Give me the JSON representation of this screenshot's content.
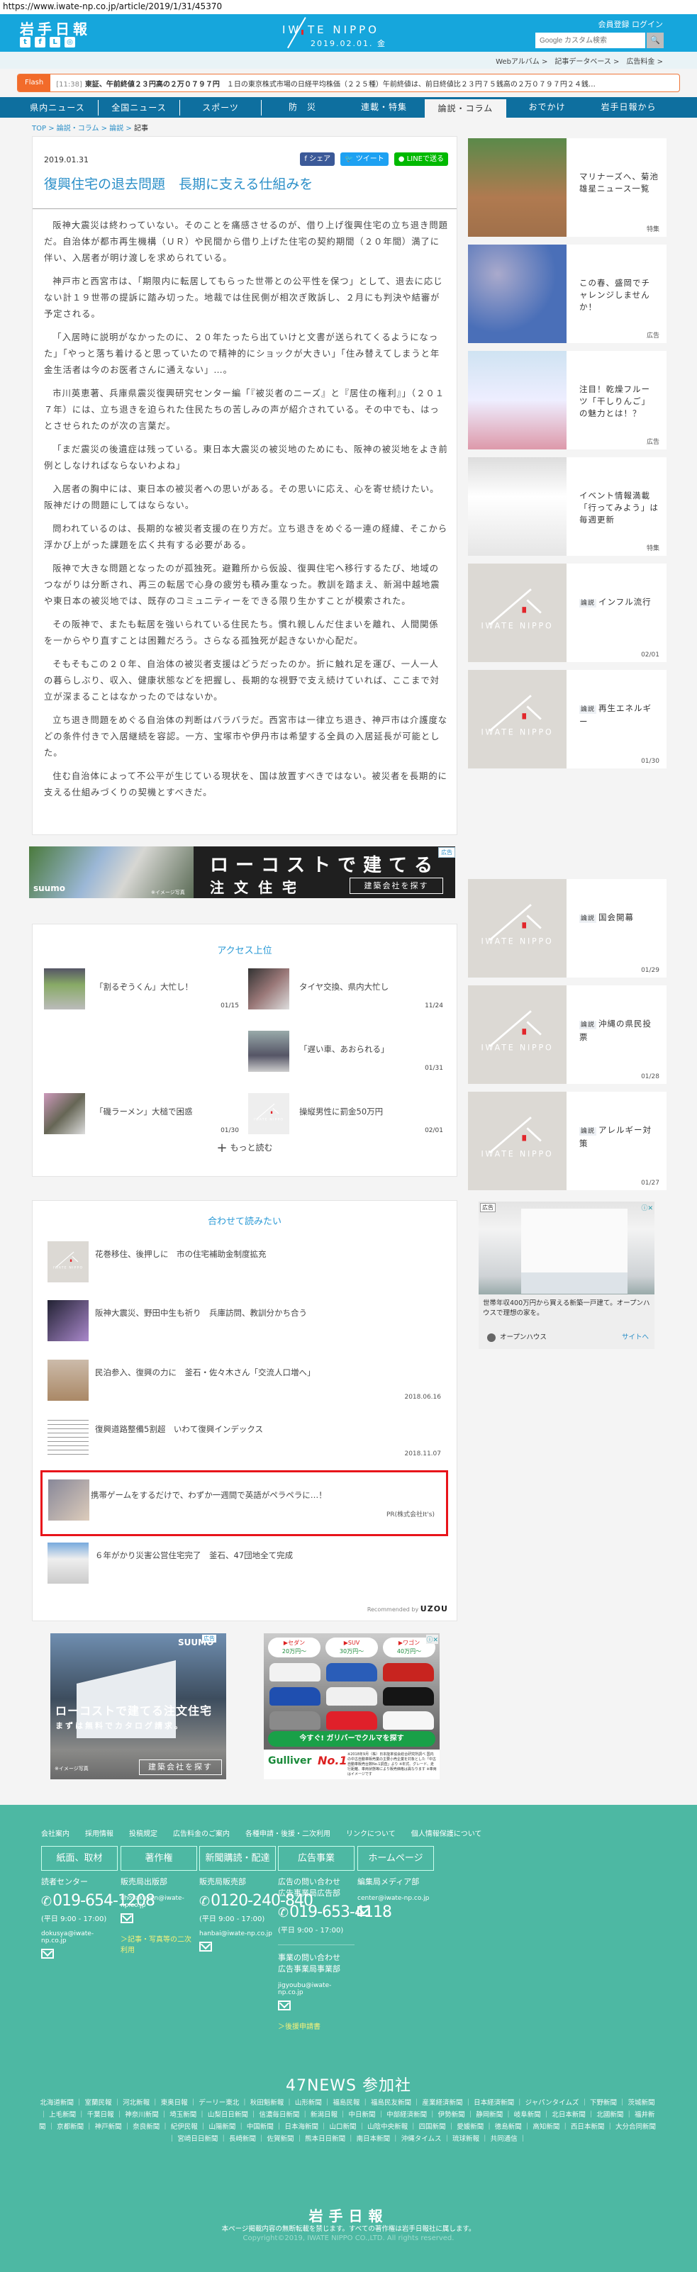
{
  "url": "https://www.iwate-np.co.jp/article/2019/1/31/45370",
  "header": {
    "logo": "岩手日報",
    "brand": "IW TE NIPPO",
    "date": "2019.02.01. 金",
    "account": "会員登録 ログイン",
    "search_placeholder": "Google カスタム検索",
    "search_icon": "🔍",
    "social": [
      "twitter-icon",
      "facebook-icon",
      "line-icon",
      "instagram-icon"
    ]
  },
  "subnav": [
    "Webアルバム >",
    "記事データベース >",
    "広告料金 >"
  ],
  "flash": {
    "label": "Flash",
    "time": "[11:38]",
    "headline": "東証、午前終値２３円高の２万０７９７円",
    "text": "１日の東京株式市場の日経平均株価（２２５種）午前終値は、前日終値比２３円７５銭高の２万０７９７円２４銭…"
  },
  "nav": [
    "県内ニュース",
    "全国ニュース",
    "スポーツ",
    "防　災",
    "連載・特集",
    "論説・コラム",
    "おでかけ",
    "岩手日報から"
  ],
  "breadcrumb": [
    "TOP",
    "論説・コラム",
    "論説",
    "記事"
  ],
  "article": {
    "date": "2019.01.31",
    "share": {
      "facebook": "シェア",
      "twitter": "ツイート",
      "line": "LINEで送る"
    },
    "title": "復興住宅の退去問題　長期に支える仕組みを",
    "paragraphs": [
      "阪神大震災は終わっていない。そのことを痛感させるのが、借り上げ復興住宅の立ち退き問題だ。自治体が都市再生機構（ＵＲ）や民間から借り上げた住宅の契約期間（２０年間）満了に伴い、入居者が明け渡しを求められている。",
      "神戸市と西宮市は、「期限内に転居してもらった世帯との公平性を保つ」として、退去に応じない計１９世帯の提訴に踏み切った。地裁では住民側が相次ぎ敗訴し、２月にも判決や結審が予定される。",
      "「入居時に説明がなかったのに、２０年たったら出ていけと文書が送られてくるようになった」「やっと落ち着けると思っていたので精神的にショックが大きい」「住み替えてしまうと年金生活者は今のお医者さんに通えない」…。",
      "市川英恵著、兵庫県震災復興研究センター編「『被災者のニーズ』と『居住の権利』」（２０１７年）には、立ち退きを迫られた住民たちの苦しみの声が紹介されている。その中でも、はっとさせられたのが次の言葉だ。",
      "「まだ震災の後遺症は残っている。東日本大震災の被災地のためにも、阪神の被災地をよき前例としなければならないわよね」",
      "入居者の胸中には、東日本の被災者への思いがある。その思いに応え、心を寄せ続けたい。阪神だけの問題にしてはならない。",
      "問われているのは、長期的な被災者支援の在り方だ。立ち退きをめぐる一連の経緯、そこから浮かび上がった課題を広く共有する必要がある。",
      "阪神で大きな問題となったのが孤独死。避難所から仮設、復興住宅へ移行するたび、地域のつながりは分断され、再三の転居で心身の疲労も積み重なった。教訓を踏まえ、新潟中越地震や東日本の被災地では、既存のコミュニティーをできる限り生かすことが模索された。",
      "その阪神で、またも転居を強いられている住民たち。慣れ親しんだ住まいを離れ、人間関係を一からやり直すことは困難だろう。さらなる孤独死が起きないか心配だ。",
      "そもそもこの２０年、自治体の被災者支援はどうだったのか。折に触れ足を運び、一人一人の暮らしぶり、収入、健康状態などを把握し、長期的な視野で支え続けていれば、ここまで対立が深まることはなかったのではないか。",
      "立ち退き問題をめぐる自治体の判断はバラバラだ。西宮市は一律立ち退き、神戸市は介護度などの条件付きで入居継続を容認。一方、宝塚市や伊丹市は希望する全員の入居延長が可能とした。",
      "住む自治体によって不公平が生じている現状を、国は放置すべきではない。被災者を長期的に支える仕組みづくりの契機とすべきだ。"
    ]
  },
  "banner_ad": {
    "logo": "suumo",
    "note": "※イメージ写真",
    "headline": "ローコストで建てる",
    "sub": "注文住宅",
    "button": "建築会社を探す",
    "ad_label": "広告"
  },
  "access": {
    "title": "アクセス上位",
    "items": [
      {
        "title": "「割るぞうくん」大忙し！",
        "date": "01/15"
      },
      {
        "title": "タイヤ交換、県内大忙し",
        "date": "11/24"
      },
      {
        "title": "「遅い車、あおられる」",
        "date": "01/31"
      },
      {
        "title": "「磯ラーメン」大槌で困惑",
        "date": "01/30"
      },
      {
        "title": "操縦男性に罰金50万円",
        "date": "02/01"
      }
    ],
    "more": "もっと読む"
  },
  "read_also": {
    "title": "合わせて読みたい",
    "items": [
      {
        "title": "花巻移住、後押しに　市の住宅補助金制度拡充",
        "date": ""
      },
      {
        "title": "阪神大震災、野田中生も祈り　兵庫訪問、教訓分かち合う",
        "date": ""
      },
      {
        "title": "民泊参入、復興の力に　釜石・佐々木さん「交流人口増へ」",
        "date": "2018.06.16"
      },
      {
        "title": "復興道路整備5割超　いわて復興インデックス",
        "date": "2018.11.07"
      },
      {
        "title": "携帯ゲームをするだけで、わずか一週間で英語がペラペラに…！",
        "date": "PR(株式会社It's)"
      },
      {
        "title": "６年がかり災害公営住宅完了　釜石、47団地全て完成",
        "date": ""
      }
    ],
    "recommended_by": "Recommended by",
    "recommender": "UZOU"
  },
  "ad_left": {
    "logo": "SUUMO",
    "ad_label": "広告",
    "line1": "ローコストで建てる注文住宅",
    "line2": "まずは無料でカタログ請求。",
    "button": "建築会社を探す",
    "note": "※イメージ写真"
  },
  "ad_right": {
    "pills": [
      {
        "type": "▶セダン",
        "price": "20万円～"
      },
      {
        "type": "▶SUV",
        "price": "30万円～"
      },
      {
        "type": "▶ワゴン",
        "price": "40万円～"
      }
    ],
    "cta": "今すぐ! ガリバーでクルマを探す",
    "brand": "Gulliver",
    "rank": "No.1",
    "fine": "※2018年9月（株）日本能率協会総合研究所調べ 国内の中古自動車販売業の主要小売企業を対象とした「中古自動車販売台数No.1調査」より ※年式、グレード、走行距離、車両状態等により販売価格は異なります ※車両はイメージです",
    "close": "ⓘ✕"
  },
  "sidebar": {
    "items": [
      {
        "tag": "",
        "title": "マリナーズへ、菊池雄星ニュース一覧",
        "meta": "特集"
      },
      {
        "tag": "",
        "title": "この春、盛岡でチャレンジしませんか！",
        "meta": "広告"
      },
      {
        "tag": "",
        "title": "注目！乾燥フルーツ「干しりんご」の魅力とは！？",
        "meta": "広告"
      },
      {
        "tag": "",
        "title": "イベント情報満載「行ってみよう」は毎週更新",
        "meta": "特集"
      },
      {
        "tag": "論説",
        "title": "インフル流行",
        "meta": "02/01"
      },
      {
        "tag": "論説",
        "title": "再生エネルギー",
        "meta": "01/30"
      },
      {
        "tag": "論説",
        "title": "国会開幕",
        "meta": "01/29"
      },
      {
        "tag": "論説",
        "title": "沖縄の県民投票",
        "meta": "01/28"
      },
      {
        "tag": "論説",
        "title": "アレルギー対策",
        "meta": "01/27"
      }
    ],
    "placeholder_logo": "IWATE NIPPO",
    "ad": {
      "label": "広告",
      "close": "ⓘ✕",
      "text": "世帯年収400万円から買える新築一戸建て。オープンハウスで理想の家を。",
      "advertiser": "オープンハウス",
      "link": "サイトへ"
    }
  },
  "footer": {
    "links": [
      "会社案内",
      "採用情報",
      "投稿規定",
      "広告料金のご案内",
      "各種申請・後援・二次利用",
      "リンクについて",
      "個人情報保護について"
    ],
    "columns": [
      {
        "heading": "紙面、取材",
        "org": "読者センター",
        "tel": "019-654-1208",
        "hours": "(平日 9:00 - 17:00)",
        "mail": "dokusya@iwate-np.co.jp"
      },
      {
        "heading": "著作権",
        "org": "販売局出版部",
        "mail": "chosakuken@iwate-np.co.jp",
        "extra": "＞記事・写真等の二次利用"
      },
      {
        "heading": "新聞購読・配達",
        "org": "販売局販売部",
        "tel": "0120-240-840",
        "hours": "(平日 9:00 - 17:00)",
        "mail": "hanbai@iwate-np.co.jp"
      },
      {
        "heading": "広告事業",
        "org": "広告の問い合わせ\n広告事業局広告部",
        "tel": "019-653-4118",
        "hours": "(平日 9:00 - 17:00)",
        "org2": "事業の問い合わせ\n広告事業局事業部",
        "mail": "jigyoubu@iwate-np.co.jp",
        "extra": "＞後援申請書"
      },
      {
        "heading": "ホームページ",
        "org": "編集局メディア部",
        "mail": "center@iwate-np.co.jp"
      }
    ],
    "news47_title": "47NEWS 参加社",
    "news47": [
      "北海道新聞",
      "室蘭民報",
      "河北新報",
      "東奥日報",
      "デーリー東北",
      "秋田魁新報",
      "山形新聞",
      "福島民報",
      "福島民友新聞",
      "産業経済新聞",
      "日本経済新聞",
      "ジャパンタイムズ",
      "下野新聞",
      "茨城新聞",
      "上毛新聞",
      "千葉日報",
      "神奈川新聞",
      "埼玉新聞",
      "山梨日日新聞",
      "信濃毎日新聞",
      "新潟日報",
      "中日新聞",
      "中部経済新聞",
      "伊勢新聞",
      "静岡新聞",
      "岐阜新聞",
      "北日本新聞",
      "北國新聞",
      "福井新聞",
      "京都新聞",
      "神戸新聞",
      "奈良新聞",
      "紀伊民報",
      "山陽新聞",
      "中国新聞",
      "日本海新聞",
      "山口新聞",
      "山陰中央新報",
      "四国新聞",
      "愛媛新聞",
      "徳島新聞",
      "高知新聞",
      "西日本新聞",
      "大分合同新聞",
      "宮崎日日新聞",
      "長崎新聞",
      "佐賀新聞",
      "熊本日日新聞",
      "南日本新聞",
      "沖縄タイムス",
      "琉球新報",
      "共同通信"
    ],
    "logo": "岩手日報",
    "rights": "本ページ掲載内容の無断転載を禁じます。すべての著作権は岩手日報社に属します。",
    "copyright": "Copyright©2019, IWATE NIPPO CO.,LTD. All rights reserved."
  }
}
